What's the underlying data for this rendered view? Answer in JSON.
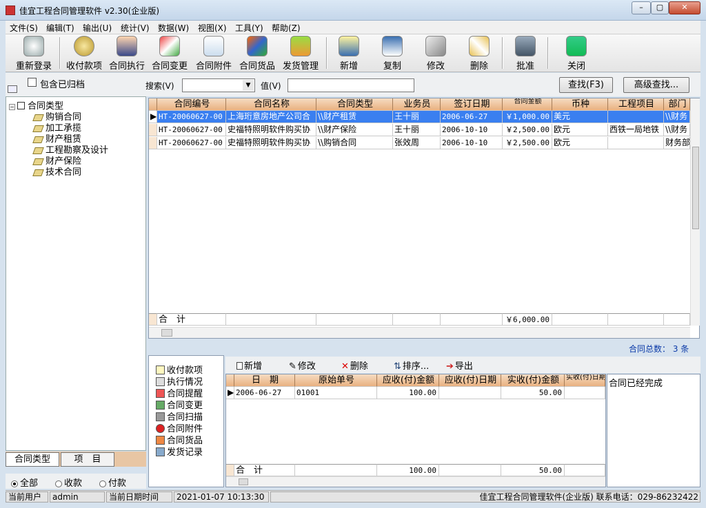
{
  "window": {
    "title": "佳宜工程合同管理软件 v2.30(企业版)"
  },
  "menu": [
    "文件(S)",
    "编辑(T)",
    "输出(U)",
    "统计(V)",
    "数据(W)",
    "视图(X)",
    "工具(Y)",
    "帮助(Z)"
  ],
  "toolbar": {
    "items": [
      {
        "label": "重新登录",
        "icon": "relogin-icon"
      },
      {
        "label": "收付款项",
        "icon": "money-bag-icon"
      },
      {
        "label": "合同执行",
        "icon": "person-execute-icon"
      },
      {
        "label": "合同变更",
        "icon": "change-icon"
      },
      {
        "label": "合同附件",
        "icon": "attachment-icon"
      },
      {
        "label": "合同货品",
        "icon": "goods-icon"
      },
      {
        "label": "发货管理",
        "icon": "shipping-icon"
      },
      {
        "label": "新增",
        "icon": "new-doc-icon"
      },
      {
        "label": "复制",
        "icon": "copy-icon"
      },
      {
        "label": "修改",
        "icon": "edit-icon"
      },
      {
        "label": "删除",
        "icon": "delete-icon"
      },
      {
        "label": "批准",
        "icon": "approve-icon"
      },
      {
        "label": "关闭",
        "icon": "exit-icon"
      }
    ]
  },
  "filter": {
    "include_archived": "包含已归档",
    "search_label": "搜索(V)",
    "value_label": "值(V)",
    "find_button": "查找(F3)",
    "advanced_button": "高级查找..."
  },
  "tree": {
    "root": "合同类型",
    "children": [
      "购销合同",
      "加工承揽",
      "财产租赁",
      "工程勘察及设计",
      "财产保险",
      "技术合同"
    ]
  },
  "left_tabs": [
    "合同类型",
    "项　目"
  ],
  "radios": [
    {
      "label": "全部",
      "selected": true
    },
    {
      "label": "收款",
      "selected": false
    },
    {
      "label": "付款",
      "selected": false
    }
  ],
  "main_grid": {
    "columns": [
      "合同编号",
      "合同名称",
      "合同类型",
      "业务员",
      "签订日期",
      "合同金额",
      "币种",
      "工程项目",
      "部门"
    ],
    "rows": [
      {
        "no": "HT-20060627-00",
        "name": "上海珩意房地产公司合",
        "type": "\\\\财产租赁",
        "staff": "王十丽",
        "date": "2006-06-27",
        "amount": "￥1,000.00",
        "currency": "美元",
        "project": "",
        "dept": "\\\\财务"
      },
      {
        "no": "HT-20060627-00",
        "name": "史福特照明软件购买协",
        "type": "\\\\财产保险",
        "staff": "王十丽",
        "date": "2006-10-10",
        "amount": "￥2,500.00",
        "currency": "欧元",
        "project": "西铁一局地铁",
        "dept": "\\\\财务"
      },
      {
        "no": "HT-20060627-00",
        "name": "史福特照明软件购买协",
        "type": "\\\\购销合同",
        "staff": "张效周",
        "date": "2006-10-10",
        "amount": "￥2,500.00",
        "currency": "欧元",
        "project": "",
        "dept": "财务部"
      }
    ],
    "total_label": "合　计",
    "total_amount": "￥6,000.00"
  },
  "count_text": "合同总数： 3 条",
  "detail_nav": [
    "收付款项",
    "执行情况",
    "合同提醒",
    "合同变更",
    "合同扫描",
    "合同附件",
    "合同货品",
    "发货记录"
  ],
  "detail_toolbar": [
    "新增",
    "修改",
    "删除",
    "排序...",
    "导出"
  ],
  "detail_grid": {
    "columns": [
      "日　期",
      "原始单号",
      "应收(付)金额",
      "应收(付)日期",
      "实收(付)金额",
      "实收(付)日期"
    ],
    "rows": [
      {
        "date": "2006-06-27",
        "doc": "01001",
        "due": "100.00",
        "due_date": "",
        "paid": "50.00"
      }
    ],
    "total_label": "合　计",
    "total_due": "100.00",
    "total_paid": "50.00"
  },
  "note": "合同已经完成",
  "status": {
    "user_label": "当前用户",
    "user": "admin",
    "date_label": "当前日期时间",
    "datetime": "2021-01-07 10:13:30",
    "company": "佳宜工程合同管理软件(企业版) 联系电话：029-86232422"
  }
}
